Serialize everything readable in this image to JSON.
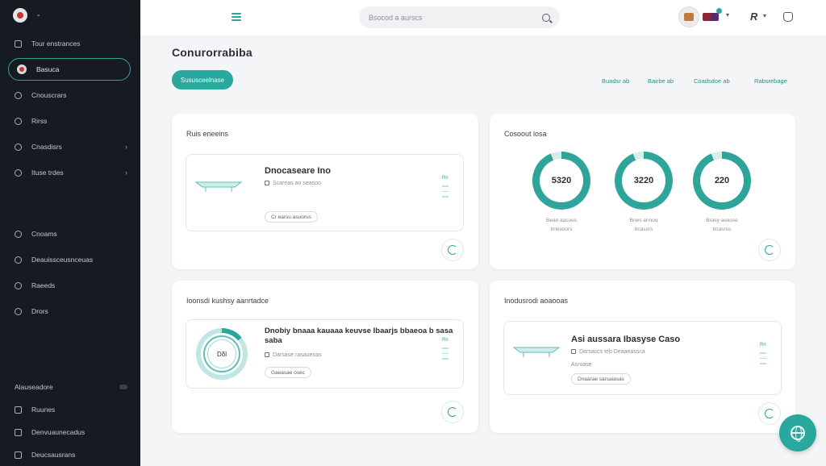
{
  "sidebar": {
    "brand": "-",
    "items": [
      {
        "label": "Tour enstrances",
        "icon": "square-icon"
      },
      {
        "label": "Basuca",
        "icon": "home-icon",
        "active": true
      },
      {
        "label": "Cnouscrars",
        "icon": "circle-icon"
      },
      {
        "label": "Rirss",
        "icon": "circle-icon"
      },
      {
        "label": "Cnasdisrs",
        "icon": "circle-icon",
        "chevron": "›"
      },
      {
        "label": "Ituse trdes",
        "icon": "circle-icon",
        "chevron": "›"
      }
    ],
    "items2": [
      {
        "label": "Cnoams",
        "icon": "circle-icon"
      },
      {
        "label": "Deauissceusnceuas",
        "icon": "circle-icon"
      },
      {
        "label": "Raeeds",
        "icon": "circle-icon"
      },
      {
        "label": "Drors",
        "icon": "circle-icon"
      }
    ],
    "bottom": [
      {
        "label": "Alauseadore",
        "icon": "settings-icon"
      },
      {
        "label": "Ruunes",
        "icon": "square-icon"
      },
      {
        "label": "Denvuaunecadus",
        "icon": "square-icon"
      },
      {
        "label": "Deucsausrans",
        "icon": "square-icon"
      }
    ]
  },
  "topbar": {
    "search_placeholder": "Bsocod a aurscs"
  },
  "main": {
    "title": "Conurorrabiba",
    "primary_button": "Sususceelnase",
    "links": [
      "Buadsr ab",
      "Bairbe ab",
      "Coadsdoe ab",
      "Rabsrebage"
    ]
  },
  "cards": {
    "c1": {
      "title": "Ruis eneeins",
      "item_title": "Dnocaseare Ino",
      "item_meta": "Scareas ao seasoo",
      "chip": "Cr earsu asuorus",
      "side_label": "Rn"
    },
    "c2": {
      "title": "Cosoout losa",
      "rings": [
        {
          "value": "5320",
          "cap1": "Bean aasues",
          "cap2": "bneusors"
        },
        {
          "value": "3220",
          "cap1": "Bnes annou",
          "cap2": "bcassrs"
        },
        {
          "value": "220",
          "cap1": "Brasy aeasse",
          "cap2": "bcasrss"
        }
      ],
      "ring_progress": 0.94
    },
    "c3": {
      "title": "Ioonsdi kushsy aanrtadce",
      "item_title_1": "Dnobiy bnaaa kauaaa keuvse Ibaarjs bbaeoa b sasa",
      "item_title_2": "saba",
      "item_meta": "Darsase rasaueoas",
      "chip": "Gaeasae osec",
      "ring_label": "Dδl",
      "ring_progress": 0.14,
      "side_label": "Rn"
    },
    "c4": {
      "title": "Inodusrodi aoaooas",
      "item_title": "Asi aussara Ibasyse Caso",
      "item_meta": "Darsaccs teb Deaaeassca",
      "chip_pre": "Asroase",
      "chip": "Dnaarae sarsaiasas",
      "side_label": "Rn"
    }
  },
  "colors": {
    "accent": "#29a99d",
    "sidebar_bg": "#161b22",
    "page_bg": "#f4f5f7"
  }
}
